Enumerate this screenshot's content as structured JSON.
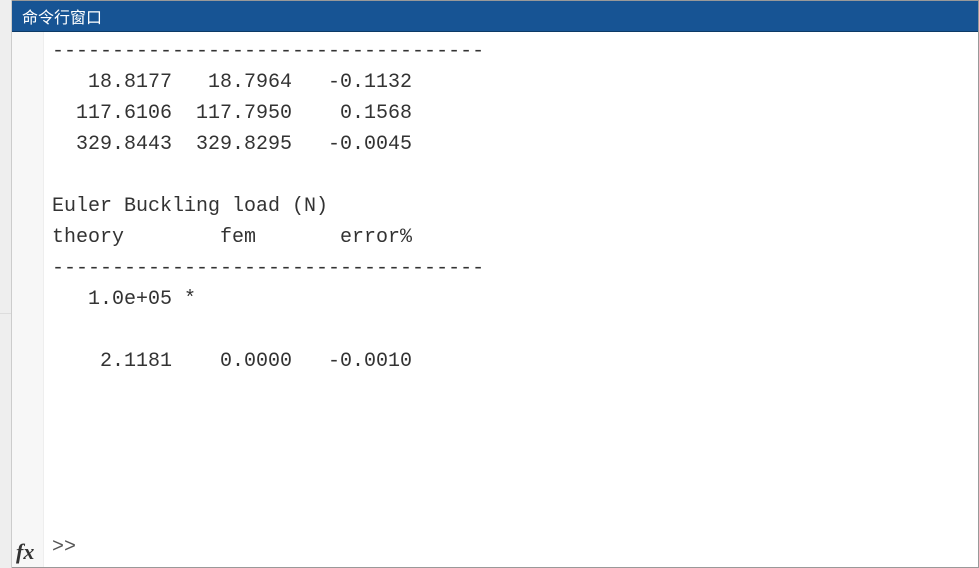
{
  "titlebar": {
    "title": "命令行窗口"
  },
  "output": {
    "lines": [
      "------------------------------------",
      "   18.8177   18.7964   -0.1132",
      "  117.6106  117.7950    0.1568",
      "  329.8443  329.8295   -0.0045",
      "",
      "Euler Buckling load (N)",
      "theory        fem       error%",
      "------------------------------------",
      "   1.0e+05 *",
      "",
      "    2.1181    0.0000   -0.0010",
      ""
    ],
    "text": "------------------------------------\n   18.8177   18.7964   -0.1132\n  117.6106  117.7950    0.1568\n  329.8443  329.8295   -0.0045\n\nEuler Buckling load (N)\ntheory        fem       error%\n------------------------------------\n   1.0e+05 *\n\n    2.1181    0.0000   -0.0010\n"
  },
  "prompt": ">>",
  "fx_label": "fx"
}
